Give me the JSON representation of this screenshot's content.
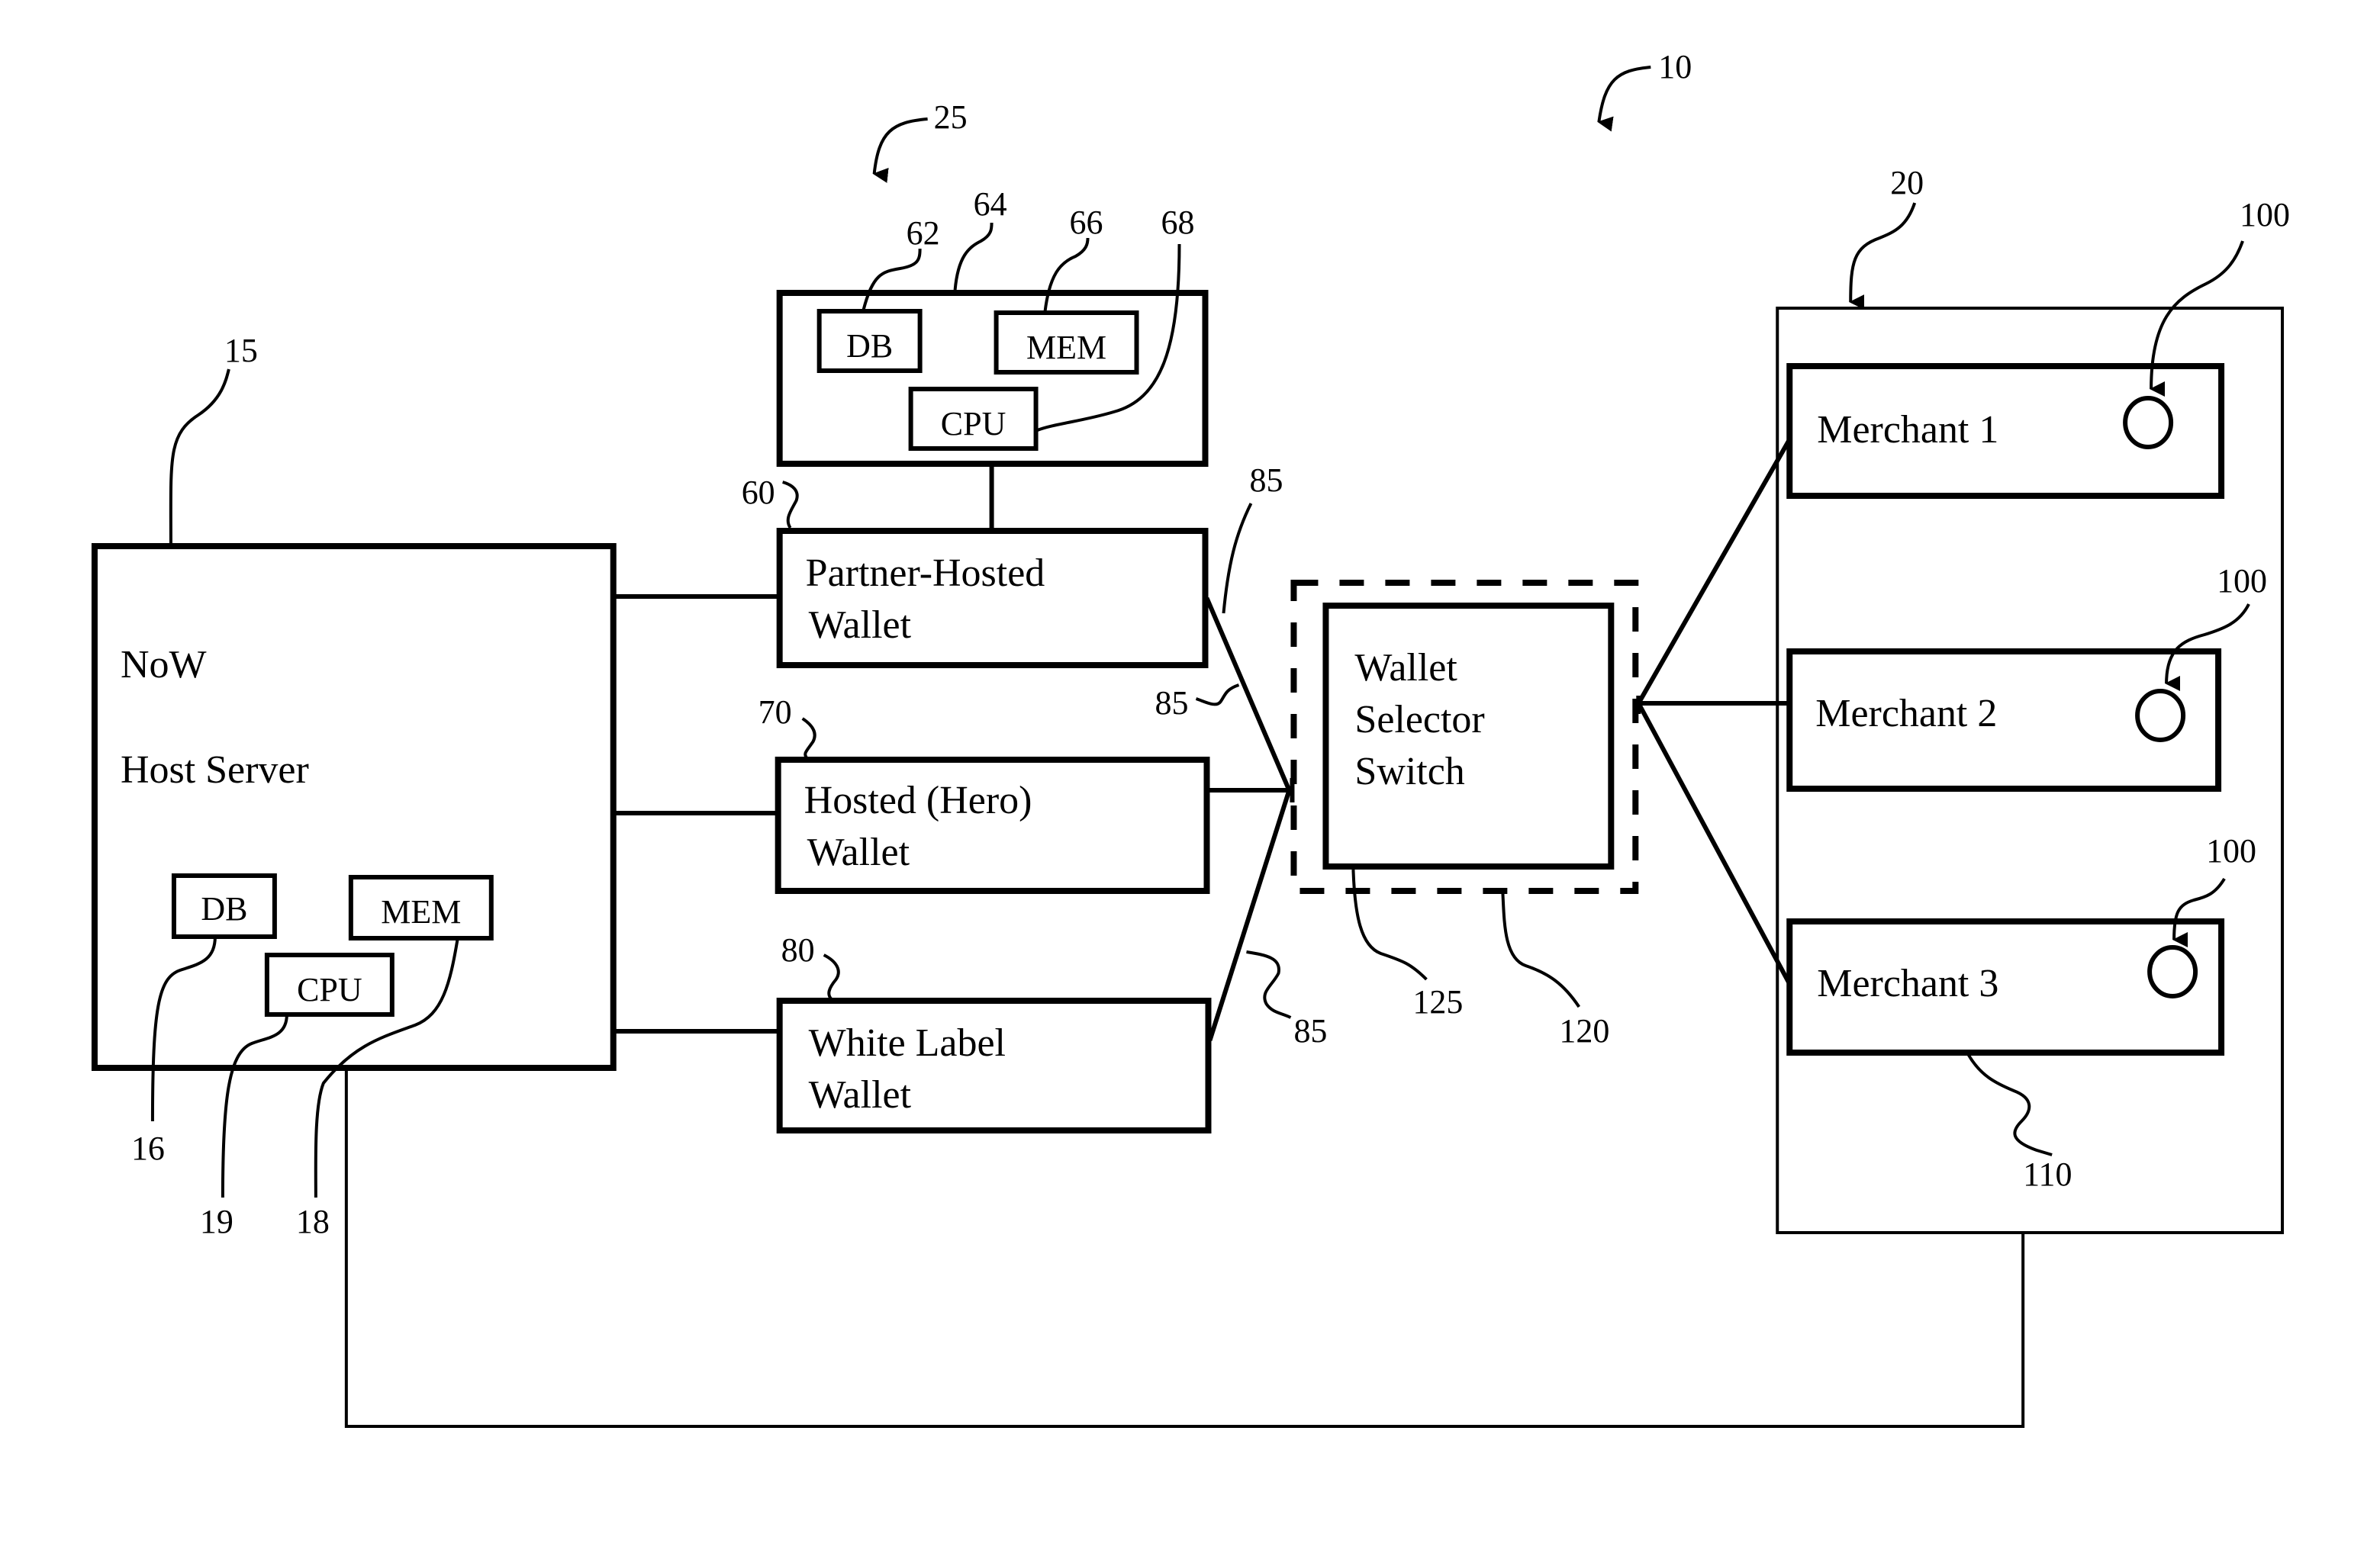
{
  "figure": {
    "system_ref": "10",
    "partner_system_ref": "25"
  },
  "host_server": {
    "ref": "15",
    "title_line1": "NoW",
    "title_line2": "Host Server",
    "db": {
      "label": "DB",
      "ref": "16"
    },
    "cpu": {
      "label": "CPU",
      "ref": "19"
    },
    "mem": {
      "label": "MEM",
      "ref": "18"
    }
  },
  "partner_server": {
    "ref": "64",
    "db": {
      "label": "DB",
      "ref": "62"
    },
    "mem": {
      "label": "MEM",
      "ref": "66"
    },
    "cpu": {
      "label": "CPU",
      "ref": "68"
    }
  },
  "wallets": [
    {
      "line1": "Partner-Hosted",
      "line2": "Wallet",
      "ref": "60"
    },
    {
      "line1": "Hosted (Hero)",
      "line2": "Wallet",
      "ref": "70"
    },
    {
      "line1": "White Label",
      "line2": "Wallet",
      "ref": "80"
    }
  ],
  "connections": {
    "refs": [
      "85",
      "85",
      "85"
    ]
  },
  "selector": {
    "line1": "Wallet",
    "line2": "Selector",
    "line3": "Switch",
    "inner_ref": "125",
    "outer_ref": "120"
  },
  "merchants_group": {
    "ref": "20",
    "merchant_ref": "110",
    "items": [
      {
        "label": "Merchant 1",
        "button_ref": "100"
      },
      {
        "label": "Merchant 2",
        "button_ref": "100"
      },
      {
        "label": "Merchant 3",
        "button_ref": "100"
      }
    ]
  }
}
